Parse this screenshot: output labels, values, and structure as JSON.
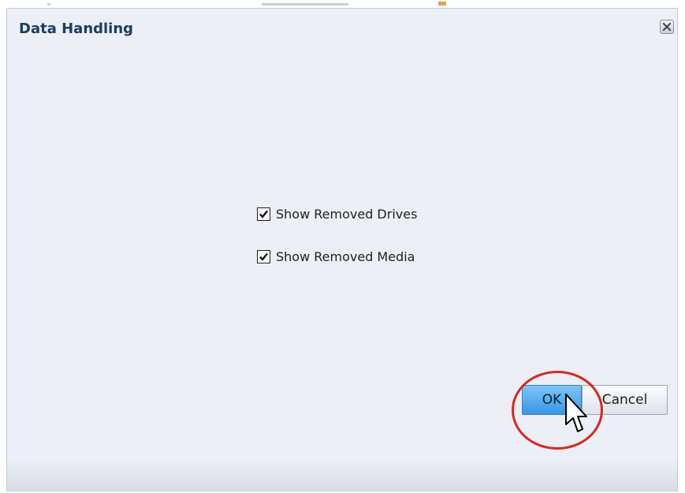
{
  "dialog": {
    "title": "Data Handling",
    "close_icon": "close-icon"
  },
  "options": [
    {
      "label": "Show Removed Drives",
      "checked": true
    },
    {
      "label": "Show Removed Media",
      "checked": true
    }
  ],
  "buttons": {
    "ok_label": "OK",
    "cancel_label": "Cancel"
  },
  "annotation": {
    "ring_color": "#d9281e"
  },
  "colors": {
    "title": "#1b3d63",
    "dialog_bg": "#eceff5",
    "ok_button": "#3796e6"
  }
}
